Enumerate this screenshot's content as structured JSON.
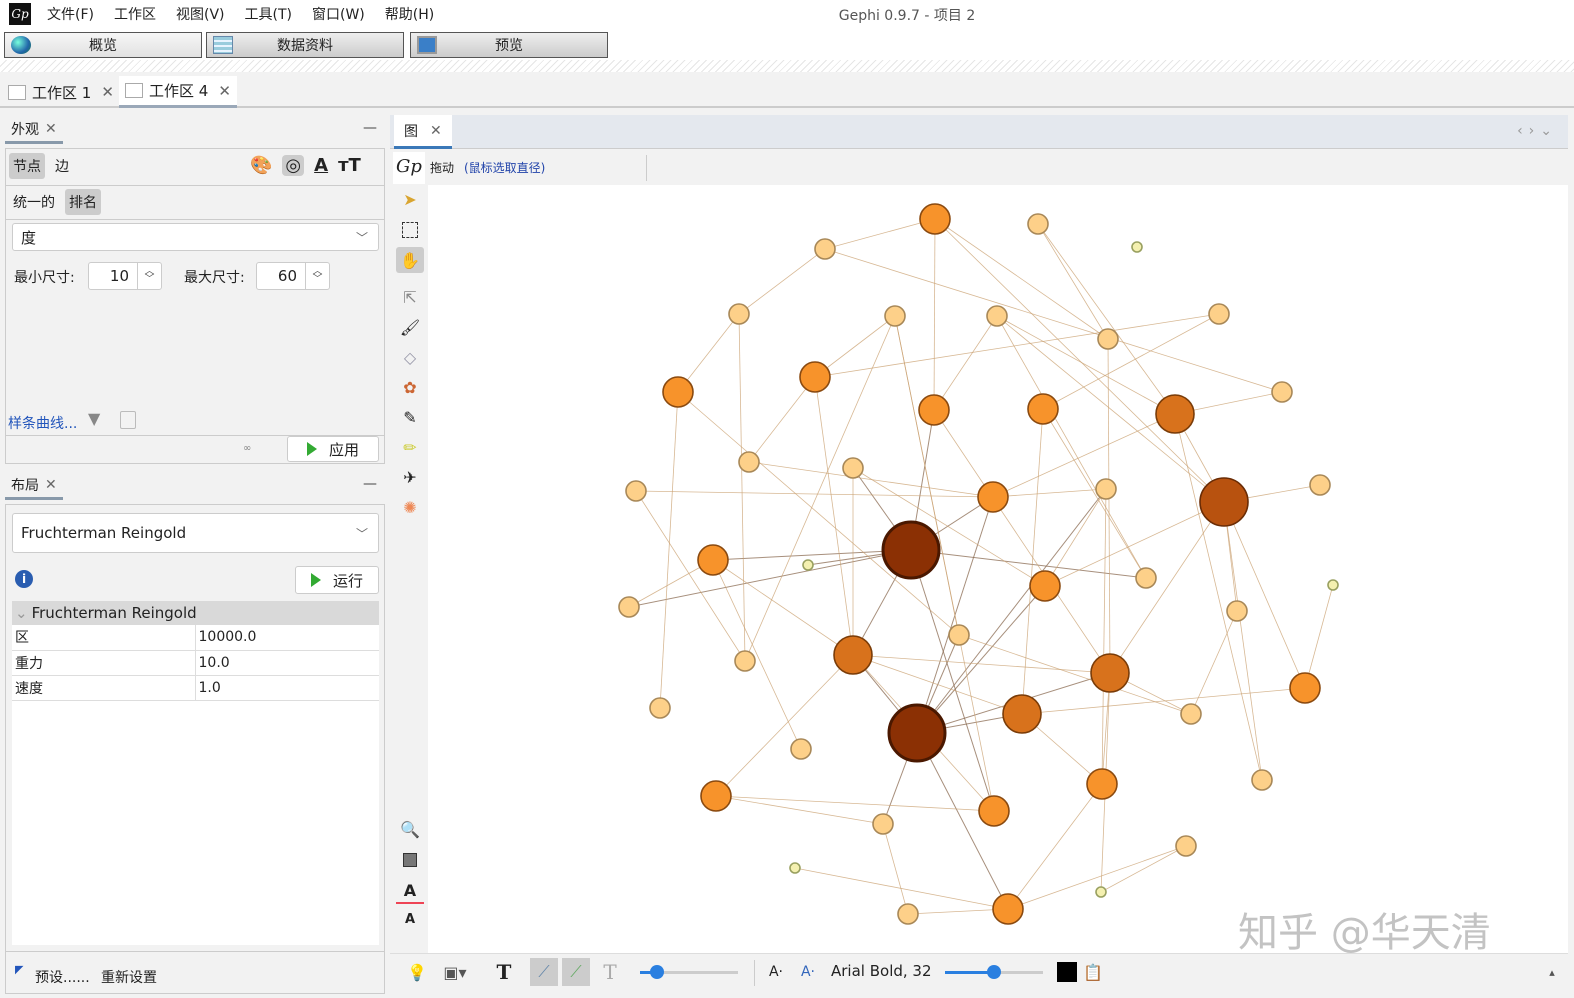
{
  "app": {
    "title": "Gephi 0.9.7 - 项目 2",
    "logo": "Gp"
  },
  "menu": [
    "文件(F)",
    "工作区",
    "视图(V)",
    "工具(T)",
    "窗口(W)",
    "帮助(H)"
  ],
  "modes": [
    {
      "label": "概览",
      "icon": "globe-icon"
    },
    {
      "label": "数据资料",
      "icon": "table-icon"
    },
    {
      "label": "预览",
      "icon": "monitor-icon"
    }
  ],
  "workspaces": [
    {
      "label": "工作区 1"
    },
    {
      "label": "工作区 4",
      "active": true
    }
  ],
  "appearance": {
    "tab": "外观",
    "node_tab": "节点",
    "edge_tab": "边",
    "uniform": "统一的",
    "ranking": "排名",
    "attribute": "度",
    "min_label": "最小尺寸:",
    "min_value": "10",
    "max_label": "最大尺寸:",
    "max_value": "60",
    "spline": "样条曲线...",
    "apply": "应用"
  },
  "layout": {
    "tab": "布局",
    "algorithm": "Fruchterman Reingold",
    "run": "运行",
    "section": "Fruchterman Reingold",
    "props": [
      {
        "k": "区",
        "v": "10000.0"
      },
      {
        "k": "重力",
        "v": "10.0"
      },
      {
        "k": "速度",
        "v": "1.0"
      }
    ],
    "presets": "预设......",
    "reset": "重新设置"
  },
  "graph": {
    "tab": "图",
    "mode": "拖动",
    "hint": "(鼠标选取直径)",
    "font": "Arial Bold, 32",
    "watermark": "知乎 @华天清"
  },
  "colors": {
    "huge": "#8b3004",
    "large": "#b8520f",
    "big": "#d8721c",
    "mid": "#f7932b",
    "small": "#fdd089",
    "edge": "#c9a070"
  }
}
